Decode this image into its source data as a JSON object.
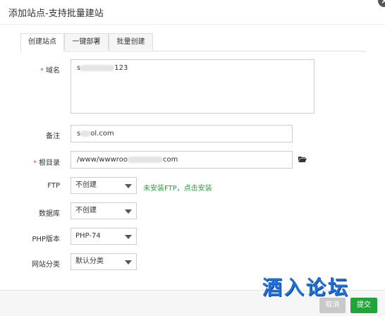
{
  "window": {
    "title": "添加站点-支持批量建站",
    "close_glyph": "×"
  },
  "tabs": [
    {
      "label": "创建站点",
      "active": true
    },
    {
      "label": "一键部署",
      "active": false
    },
    {
      "label": "批量创建",
      "active": false
    }
  ],
  "form": {
    "domain": {
      "label": "域名",
      "required_mark": "*",
      "value_start": "s",
      "value_end": "123"
    },
    "remark": {
      "label": "备注",
      "value_start": "s",
      "value_end": "ol.com"
    },
    "root_dir": {
      "label": "根目录",
      "required_mark": "*",
      "value_start": "/www/wwwroo",
      "value_end": "com"
    },
    "ftp": {
      "label": "FTP",
      "selected": "不创建",
      "hint": "未安装FTP，点击安装"
    },
    "database": {
      "label": "数据库",
      "selected": "不创建"
    },
    "php_version": {
      "label": "PHP版本",
      "selected": "PHP-74"
    },
    "site_category": {
      "label": "网站分类",
      "selected": "默认分类"
    }
  },
  "footer": {
    "cancel_label": "取消",
    "submit_label": "提交"
  },
  "watermark": {
    "text": "酒入论坛"
  },
  "colors": {
    "accent_green": "#20a53a",
    "required_red": "#e74c3c",
    "watermark_blue": "#1e6fd9"
  },
  "icons": {
    "folder": "folder-open-icon",
    "dropdown": "chevron-down-icon",
    "close": "close-icon"
  }
}
